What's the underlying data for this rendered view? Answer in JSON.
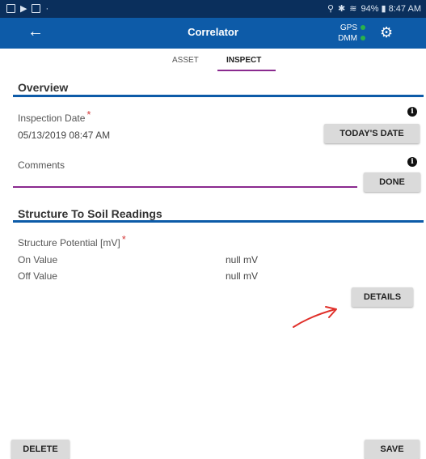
{
  "status_bar": {
    "left_text": "·",
    "right_text": "94% ▮ 8:47 AM"
  },
  "app_bar": {
    "title": "Correlator",
    "gps_label": "GPS",
    "dmm_label": "DMM"
  },
  "tabs": [
    {
      "label": "ASSET",
      "active": false
    },
    {
      "label": "INSPECT",
      "active": true
    }
  ],
  "overview": {
    "title": "Overview",
    "inspection_date_label": "Inspection Date",
    "required_mark": "*",
    "inspection_date_value": "05/13/2019 08:47 AM",
    "todays_date_button": "TODAY'S DATE",
    "comments_label": "Comments",
    "comments_value": "",
    "done_button": "DONE",
    "info_glyph": "i"
  },
  "readings": {
    "title": "Structure To Soil Readings",
    "structure_potential_label": "Structure Potential [mV]",
    "required_mark": "*",
    "rows": [
      {
        "label": "On Value",
        "value": "null mV"
      },
      {
        "label": "Off Value",
        "value": "null mV"
      }
    ],
    "details_button": "DETAILS"
  },
  "footer": {
    "delete_button": "DELETE",
    "save_button": "SAVE"
  },
  "colors": {
    "status_bar": "#0a2f5c",
    "app_bar": "#0d5ba8",
    "accent": "#8a2a8f",
    "indicator_green": "#2ab24a",
    "arrow_red": "#e0302a"
  }
}
